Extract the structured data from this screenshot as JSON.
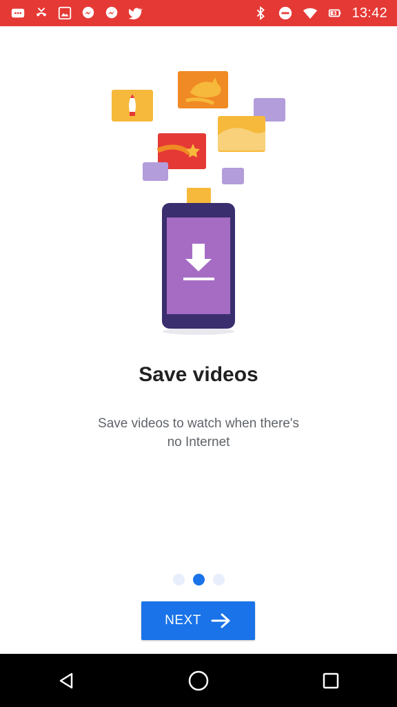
{
  "status_bar": {
    "time": "13:42",
    "left_icons": [
      "messages-icon",
      "missed-call-icon",
      "image-icon",
      "messenger-icon",
      "messenger-icon",
      "twitter-icon"
    ],
    "right_icons": [
      "bluetooth-icon",
      "do-not-disturb-icon",
      "wifi-icon",
      "battery-icon"
    ],
    "bar_color": "#e53935"
  },
  "onboarding": {
    "title": "Save videos",
    "subtitle": "Save videos to watch when there's no Internet",
    "page_indicator": {
      "total": 3,
      "active": 2
    },
    "next_label": "NEXT",
    "accent": "#1a73e8"
  },
  "nav_bar": {
    "buttons": [
      "back-icon",
      "home-icon",
      "recents-icon"
    ]
  }
}
